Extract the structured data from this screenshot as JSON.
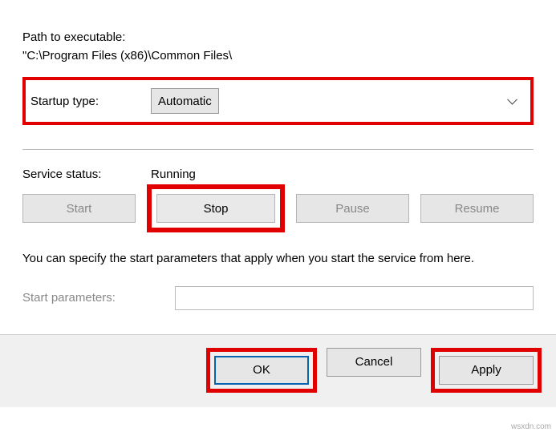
{
  "path": {
    "label": "Path to executable:",
    "value": "\"C:\\Program Files (x86)\\Common Files\\"
  },
  "startup": {
    "label": "Startup type:",
    "selected": "Automatic"
  },
  "status": {
    "label": "Service status:",
    "value": "Running"
  },
  "buttons": {
    "start": "Start",
    "stop": "Stop",
    "pause": "Pause",
    "resume": "Resume"
  },
  "description": "You can specify the start parameters that apply when you start the service from here.",
  "params": {
    "label": "Start parameters:",
    "value": ""
  },
  "dialog": {
    "ok": "OK",
    "cancel": "Cancel",
    "apply": "Apply"
  },
  "watermark": "wsxdn.com"
}
